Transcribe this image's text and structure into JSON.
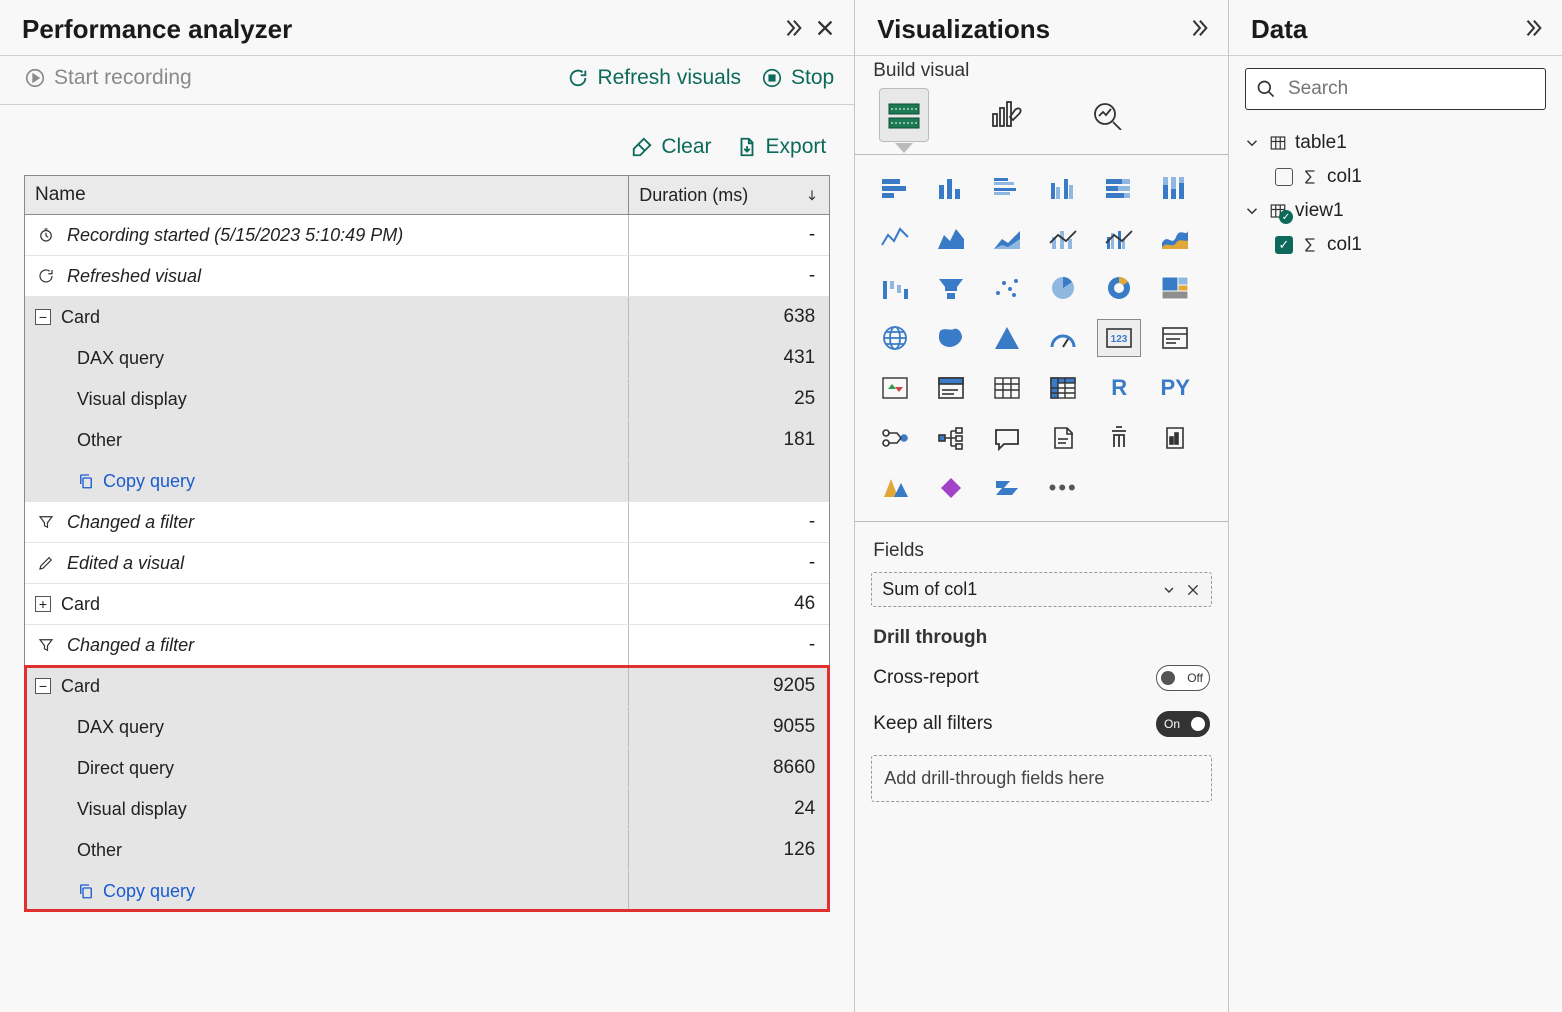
{
  "perf": {
    "title": "Performance analyzer",
    "start_recording": "Start recording",
    "refresh_visuals": "Refresh visuals",
    "stop": "Stop",
    "clear": "Clear",
    "export": "Export",
    "col_name": "Name",
    "col_duration": "Duration (ms)",
    "rows": {
      "recording_started": "Recording started (5/15/2023 5:10:49 PM)",
      "refreshed_visual": "Refreshed visual",
      "card1": "Card",
      "card1_dur": "638",
      "card1_dax": "DAX query",
      "card1_dax_dur": "431",
      "card1_vis": "Visual display",
      "card1_vis_dur": "25",
      "card1_other": "Other",
      "card1_other_dur": "181",
      "copy_query": "Copy query",
      "changed_filter": "Changed a filter",
      "edited_visual": "Edited a visual",
      "card2": "Card",
      "card2_dur": "46",
      "changed_filter2": "Changed a filter",
      "card3": "Card",
      "card3_dur": "9205",
      "card3_dax": "DAX query",
      "card3_dax_dur": "9055",
      "card3_direct": "Direct query",
      "card3_direct_dur": "8660",
      "card3_vis": "Visual display",
      "card3_vis_dur": "24",
      "card3_other": "Other",
      "card3_other_dur": "126",
      "dash": "-"
    }
  },
  "viz": {
    "title": "Visualizations",
    "subtitle": "Build visual",
    "fields_label": "Fields",
    "field_value": "Sum of col1",
    "drill_label": "Drill through",
    "cross_report": "Cross-report",
    "keep_filters": "Keep all filters",
    "off": "Off",
    "on": "On",
    "drop_hint": "Add drill-through fields here",
    "r_label": "R",
    "py_label": "PY",
    "kpi_label": "123"
  },
  "data": {
    "title": "Data",
    "search_placeholder": "Search",
    "table1": "table1",
    "table1_col1": "col1",
    "view1": "view1",
    "view1_col1": "col1"
  }
}
